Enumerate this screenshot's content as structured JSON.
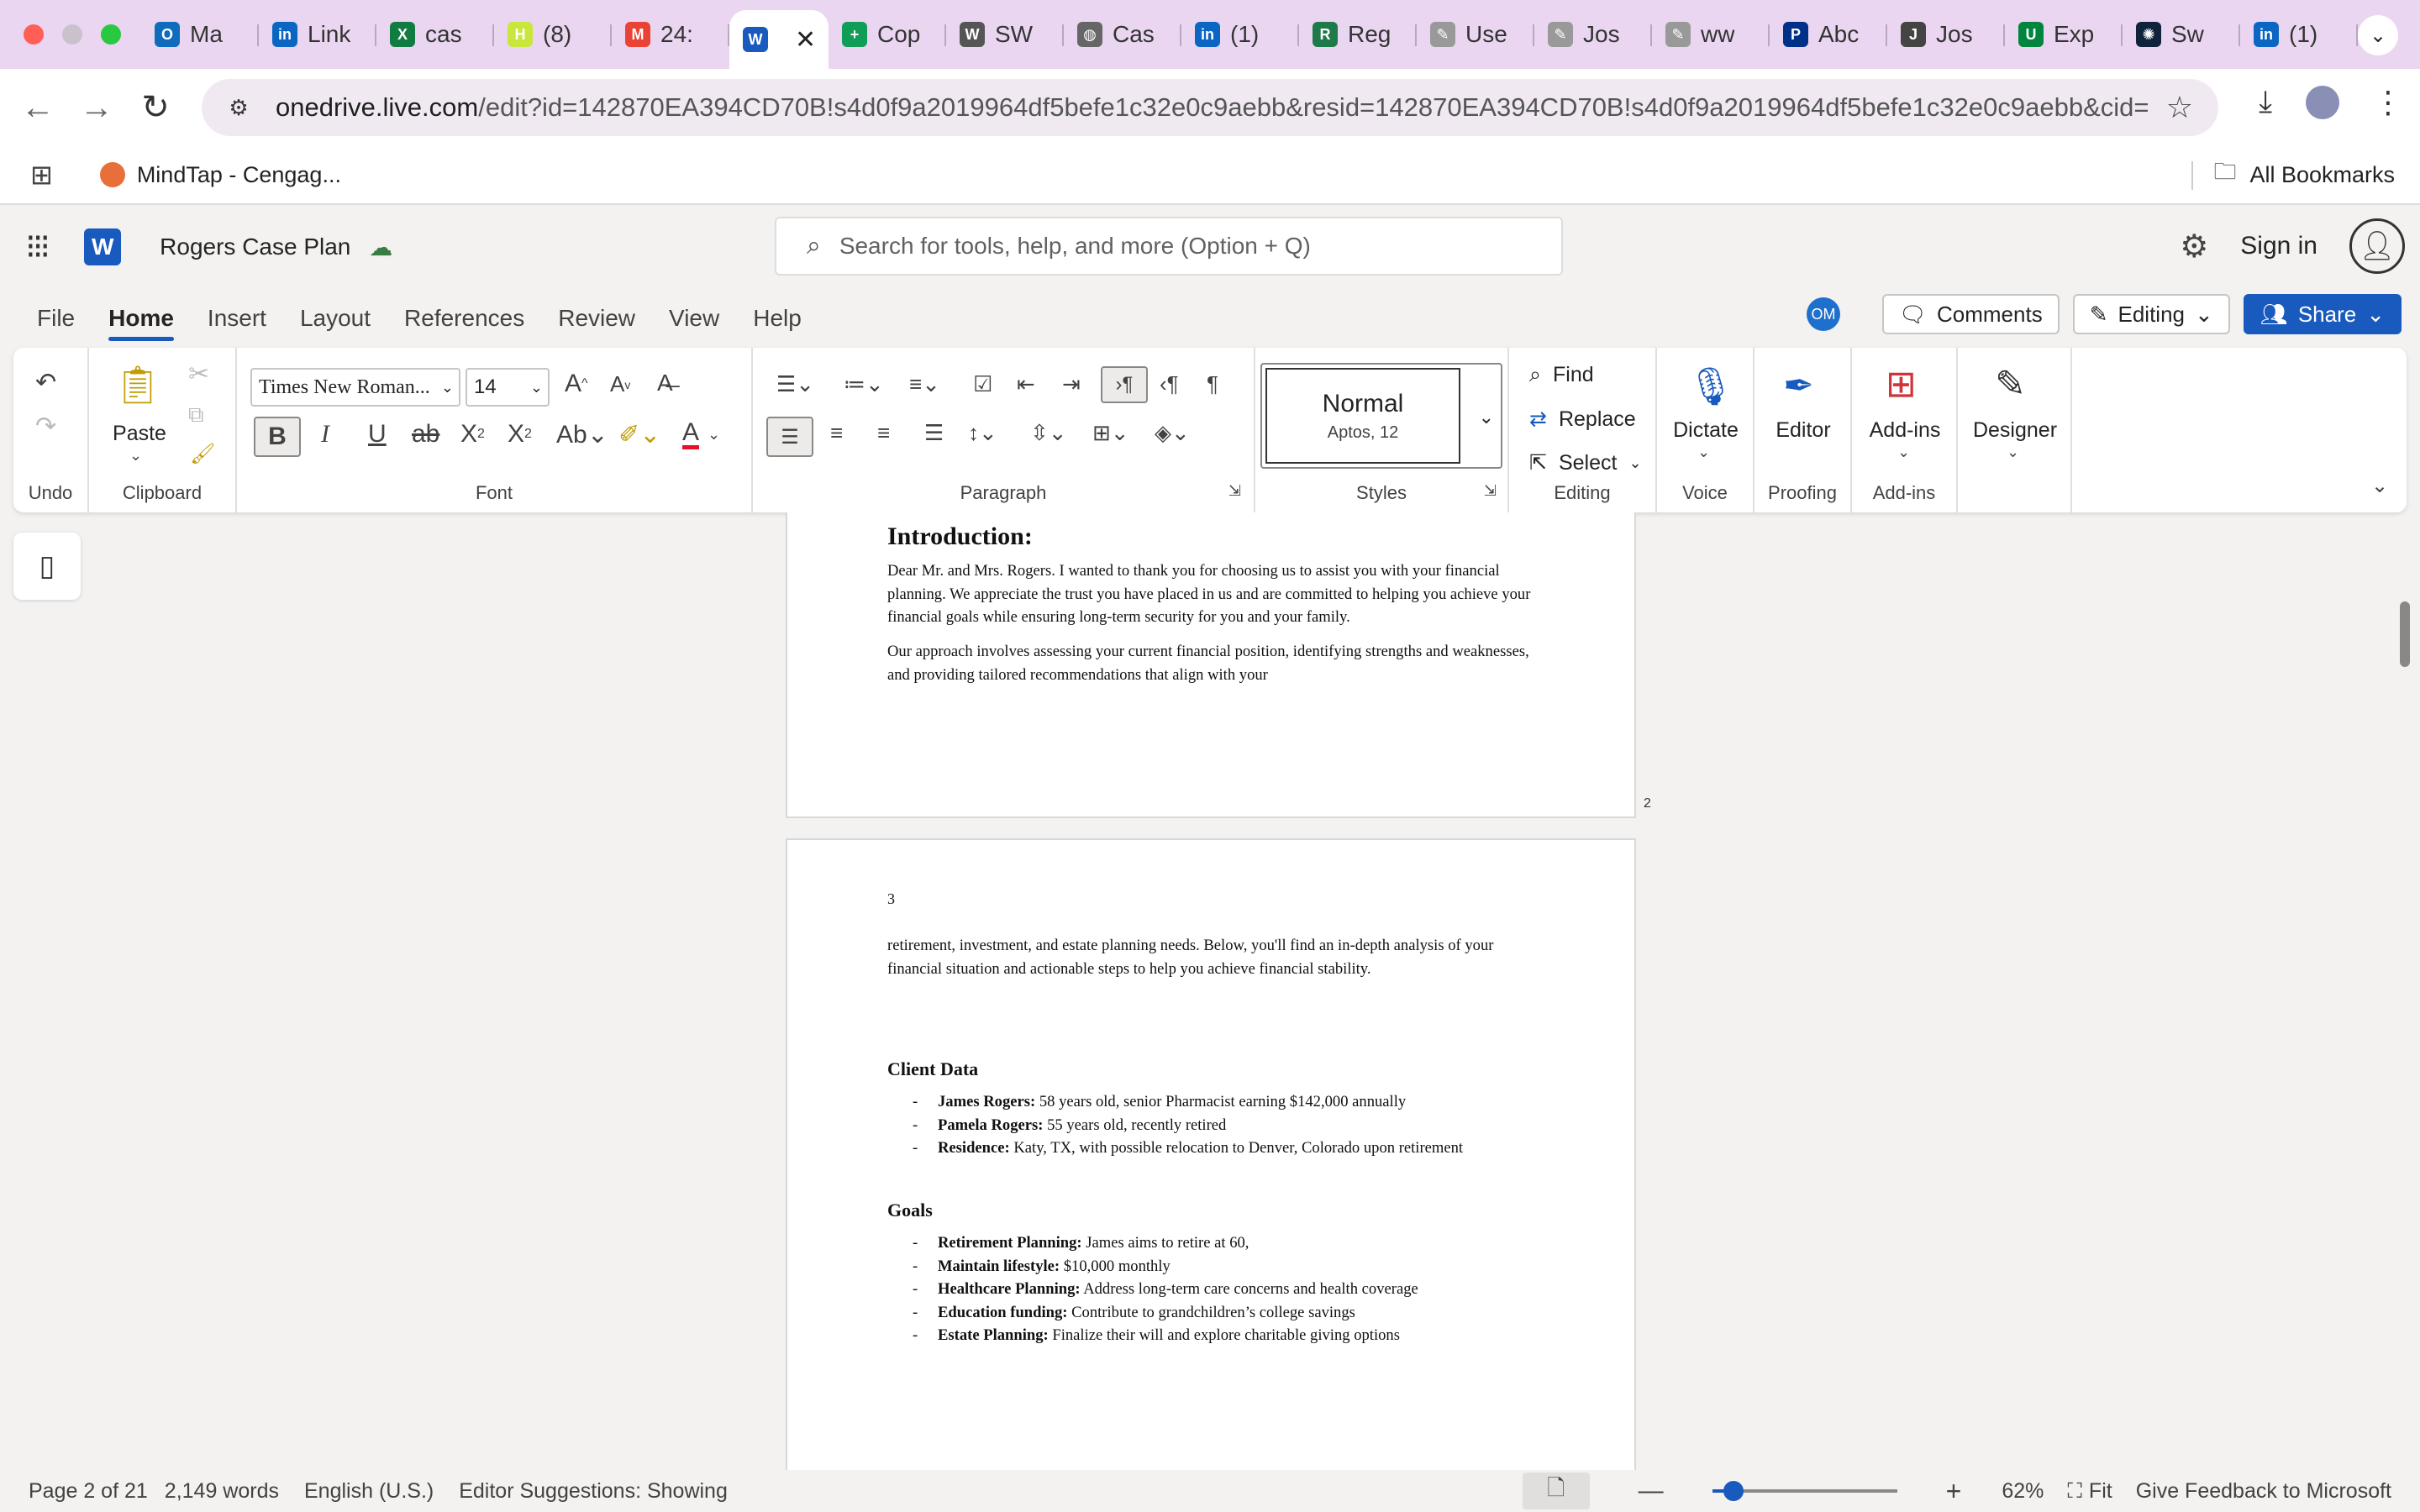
{
  "browser": {
    "tabs": [
      {
        "label": "Ma",
        "icon": "outlook-icon",
        "color": "#0f6cbd",
        "glyph": "O"
      },
      {
        "label": "Link",
        "icon": "linkedin-icon",
        "color": "#0a66c2",
        "glyph": "in"
      },
      {
        "label": "cas",
        "icon": "excel-icon",
        "color": "#107c41",
        "glyph": "X"
      },
      {
        "label": "(8)",
        "icon": "h-icon",
        "color": "#c8e63c",
        "glyph": "H"
      },
      {
        "label": "24:",
        "icon": "gmail-icon",
        "color": "#ea4335",
        "glyph": "M"
      },
      {
        "label": "",
        "icon": "word-icon",
        "color": "#185abd",
        "glyph": "W",
        "active": true
      },
      {
        "label": "Cop",
        "icon": "sheets-icon",
        "color": "#0f9d58",
        "glyph": "+"
      },
      {
        "label": "SW",
        "icon": "wikipedia-icon",
        "color": "#555555",
        "glyph": "W"
      },
      {
        "label": "Cas",
        "icon": "globe-icon",
        "color": "#666666",
        "glyph": "◍"
      },
      {
        "label": "(1)",
        "icon": "linkedin-icon",
        "color": "#0a66c2",
        "glyph": "in"
      },
      {
        "label": "Reg",
        "icon": "reg-icon",
        "color": "#1f7a4a",
        "glyph": "R"
      },
      {
        "label": "Use",
        "icon": "signature-icon",
        "color": "#999999",
        "glyph": "✎"
      },
      {
        "label": "Jos",
        "icon": "signature-icon",
        "color": "#999999",
        "glyph": "✎"
      },
      {
        "label": "ww",
        "icon": "signature-icon",
        "color": "#999999",
        "glyph": "✎"
      },
      {
        "label": "Abc",
        "icon": "paypal-icon",
        "color": "#003087",
        "glyph": "P"
      },
      {
        "label": "Jos",
        "icon": "jpix-icon",
        "color": "#444444",
        "glyph": "J"
      },
      {
        "label": "Exp",
        "icon": "unt-icon",
        "color": "#00853e",
        "glyph": "U"
      },
      {
        "label": "Sw",
        "icon": "openai-icon",
        "color": "#10233d",
        "glyph": "✺"
      },
      {
        "label": "(1)",
        "icon": "linkedin-icon",
        "color": "#0a66c2",
        "glyph": "in"
      }
    ],
    "url_host": "onedrive.live.com",
    "url_path": "/edit?id=142870EA394CD70B!s4d0f9a2019964df5befe1c32e0c9aebb&resid=142870EA394CD70B!s4d0f9a2019964df5befe1c32e0c9aebb&cid=142...",
    "bookmark": "MindTap - Cengag...",
    "all_bookmarks": "All Bookmarks"
  },
  "word": {
    "doc_title": "Rogers Case Plan",
    "search_placeholder": "Search for tools, help, and more (Option + Q)",
    "sign_in": "Sign in",
    "menu": [
      "File",
      "Home",
      "Insert",
      "Layout",
      "References",
      "Review",
      "View",
      "Help"
    ],
    "active_menu": "Home",
    "user_initials": "OM",
    "comments": "Comments",
    "editing": "Editing",
    "share": "Share"
  },
  "ribbon": {
    "undo_label": "Undo",
    "paste_label": "Paste",
    "clipboard_label": "Clipboard",
    "font_name": "Times New Roman...",
    "font_size": "14",
    "font_label": "Font",
    "paragraph_label": "Paragraph",
    "style_name": "Normal",
    "style_sub": "Aptos, 12",
    "styles_label": "Styles",
    "find": "Find",
    "replace": "Replace",
    "select": "Select",
    "editing_label": "Editing",
    "dictate": "Dictate",
    "voice_label": "Voice",
    "editor": "Editor",
    "proofing_label": "Proofing",
    "addins": "Add-ins",
    "addins_label": "Add-ins",
    "designer": "Designer",
    "accent_color": "#185abd",
    "font_color": "#e81123"
  },
  "document": {
    "page2_number": "2",
    "heading": "Introduction:",
    "para1": "Dear Mr. and Mrs. Rogers. I wanted to thank you for choosing us to assist you with your financial planning. We appreciate the trust you have placed in us and are committed to helping you achieve your financial goals while ensuring long-term security for you and your family.",
    "para2": "Our approach involves assessing your current financial position, identifying strengths and weaknesses, and providing tailored recommendations that align with your",
    "page3_number": "3",
    "para3": "retirement, investment, and estate planning needs. Below, you'll find an in-depth analysis of your financial situation and actionable steps to help you achieve financial stability.",
    "client_heading": "Client Data",
    "client_items": [
      {
        "label": "James Rogers:",
        "text": " 58 years old, senior Pharmacist earning $142,000 annually"
      },
      {
        "label": "Pamela Rogers:",
        "text": " 55 years old, recently retired"
      },
      {
        "label": "Residence:",
        "text": " Katy, TX, with possible relocation to Denver, Colorado upon retirement"
      }
    ],
    "goals_heading": "Goals",
    "goal_items": [
      {
        "label": "Retirement Planning:",
        "text": " James aims to retire at 60,"
      },
      {
        "label": "Maintain lifestyle:",
        "text": " $10,000 monthly"
      },
      {
        "label": "Healthcare Planning:",
        "text": " Address long-term care concerns and health coverage"
      },
      {
        "label": "Education funding:",
        "text": " Contribute to grandchildren’s college savings"
      },
      {
        "label": "Estate Planning:",
        "text": " Finalize their will and explore charitable giving options"
      }
    ]
  },
  "status": {
    "page": "Page 2 of 21",
    "words": "2,149 words",
    "language": "English (U.S.)",
    "editor": "Editor Suggestions: Showing",
    "zoom": "62%",
    "zoom_fraction": 0.08,
    "fit": "Fit",
    "feedback": "Give Feedback to Microsoft"
  }
}
